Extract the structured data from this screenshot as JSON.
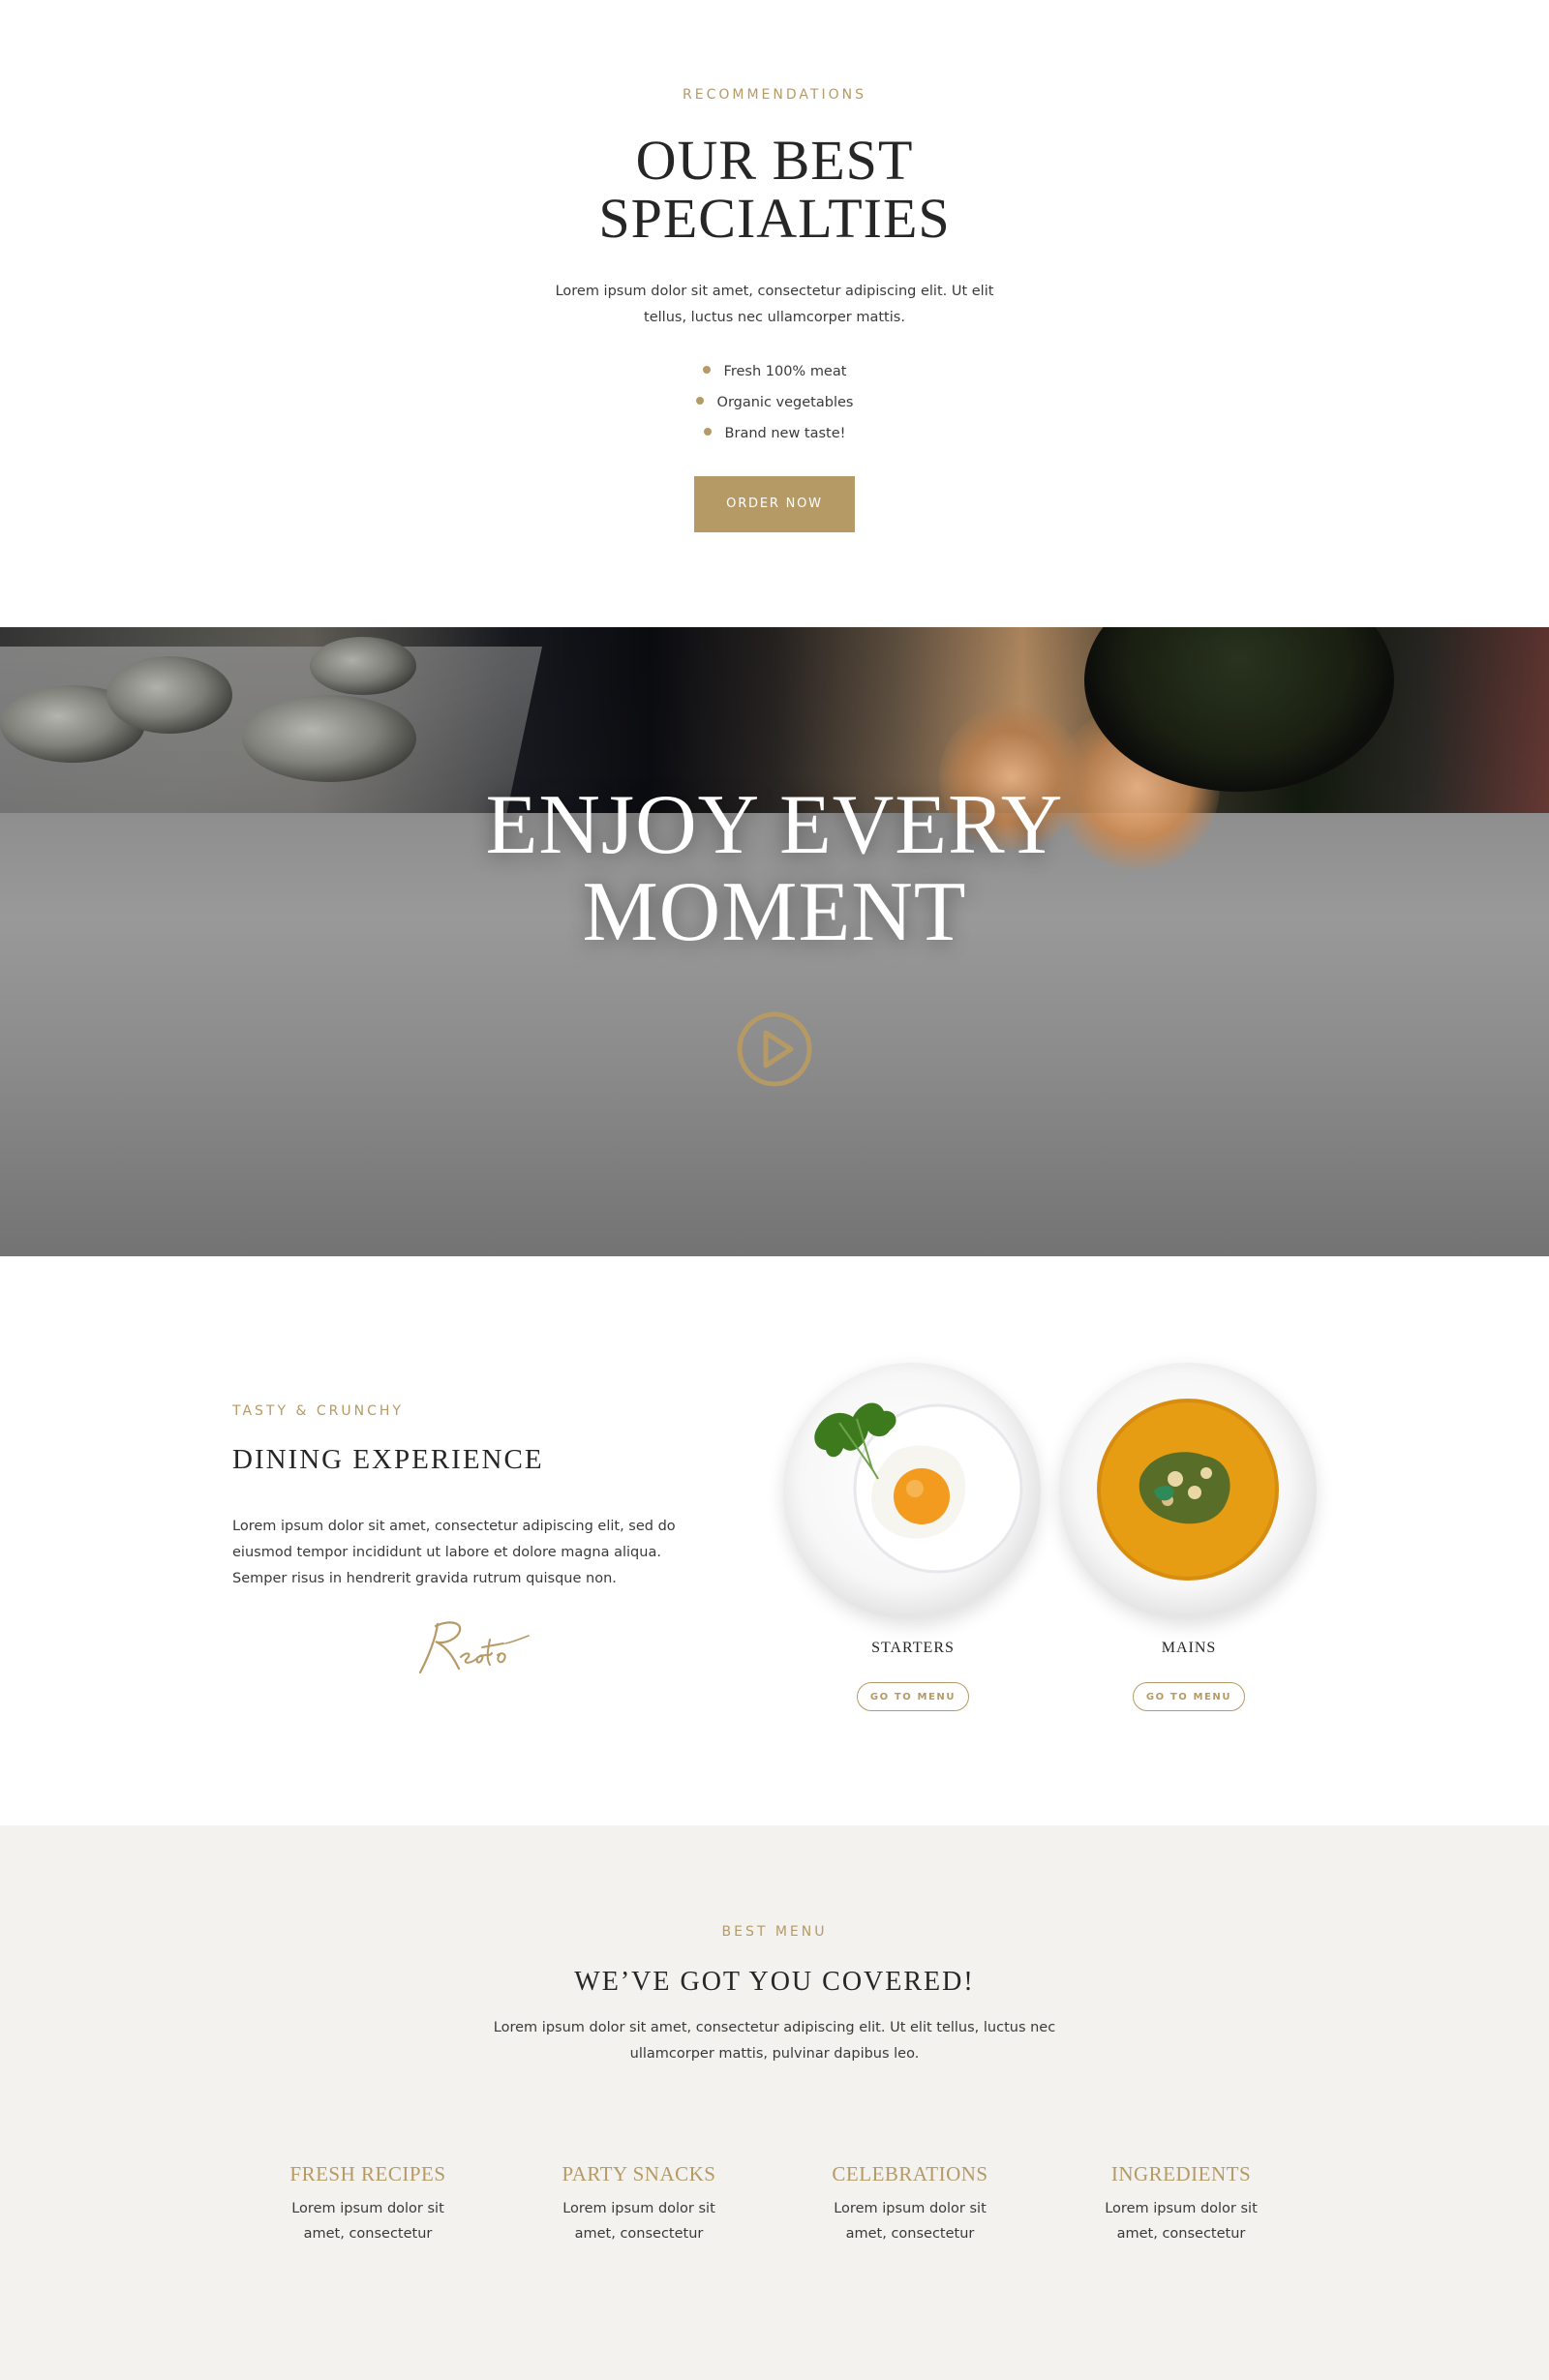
{
  "recommendations": {
    "eyebrow": "RECOMMENDATIONS",
    "title_line1": "OUR BEST",
    "title_line2": "SPECIALTIES",
    "description": "Lorem ipsum dolor sit amet, consectetur adipiscing elit. Ut elit tellus, luctus nec ullamcorper mattis.",
    "bullets": [
      "Fresh 100% meat",
      "Organic vegetables",
      "Brand new taste!"
    ],
    "button_label": "ORDER NOW"
  },
  "hero": {
    "title_line1": "ENJOY EVERY",
    "title_line2": "MOMENT",
    "play_icon": "play-circle-icon"
  },
  "dining": {
    "eyebrow": "TASTY & CRUNCHY",
    "title": "DINING EXPERIENCE",
    "description": "Lorem ipsum dolor sit amet, consectetur adipiscing elit, sed do eiusmod tempor incididunt ut labore et dolore magna aliqua. Semper risus in hendrerit gravida rutrum quisque non.",
    "signature": "Resto",
    "dishes": [
      {
        "label": "STARTERS",
        "button_label": "GO TO MENU",
        "icon": "fried-egg-plate-image"
      },
      {
        "label": "MAINS",
        "button_label": "GO TO MENU",
        "icon": "soup-bowl-image"
      }
    ]
  },
  "menu": {
    "eyebrow": "BEST MENU",
    "title": "WE’VE GOT YOU COVERED!",
    "description": "Lorem ipsum dolor sit amet, consectetur adipiscing elit. Ut elit tellus, luctus nec ullamcorper mattis, pulvinar dapibus leo.",
    "features": [
      {
        "title": "FRESH RECIPES",
        "text": "Lorem ipsum dolor sit amet, consectetur"
      },
      {
        "title": "PARTY SNACKS",
        "text": "Lorem ipsum dolor sit amet, consectetur"
      },
      {
        "title": "CELEBRATIONS",
        "text": "Lorem ipsum dolor sit amet, consectetur"
      },
      {
        "title": "INGREDIENTS",
        "text": "Lorem ipsum dolor sit amet, consectetur"
      }
    ]
  },
  "colors": {
    "accent": "#b59a66",
    "text": "#262626",
    "menu_background": "#f3f2ee"
  }
}
